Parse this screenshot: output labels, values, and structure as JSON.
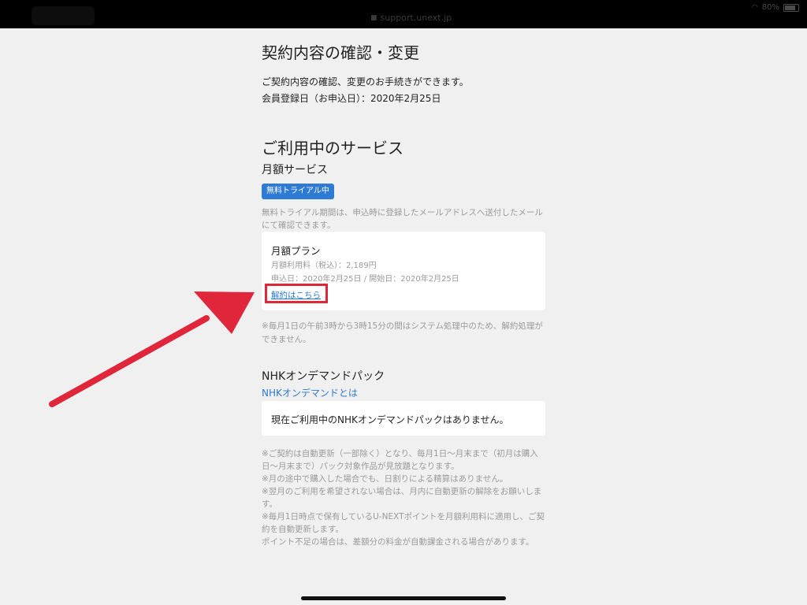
{
  "status_bar": {
    "url": "support.unext.jp",
    "battery": "80%"
  },
  "page": {
    "title": "契約内容の確認・変更",
    "intro_line1": "ご契約内容の確認、変更のお手続きができます。",
    "intro_line2": "会員登録日（お申込日）：2020年2月25日"
  },
  "services": {
    "title": "ご利用中のサービス",
    "monthly_title": "月額サービス",
    "trial_badge": "無料トライアル中",
    "trial_note": "無料トライアル期間は、申込時に登録したメールアドレスへ送付したメールにて確認できます。",
    "plan": {
      "name": "月額プラン",
      "fee": "月額利用料（税込）：2,189円",
      "dates": "申込日：2020年2月25日 / 開始日：2020年2月25日",
      "cancel_link": "解約はこちら"
    },
    "maintenance_note": "※毎月1日の午前3時から3時15分の間はシステム処理中のため、解約処理ができません。"
  },
  "nhk": {
    "title": "NHKオンデマンドパック",
    "about_link": "NHKオンデマンドとは",
    "card_text": "現在ご利用中のNHKオンデマンドパックはありません。",
    "notes": [
      "※ご契約は自動更新（一部除く）となり、毎月1日〜月末まで（初月は購入日〜月末まで）パック対象作品が見放題となります。",
      "※月の途中で購入した場合でも、日割りによる精算はありません。",
      "※翌月のご利用を希望されない場合は、月内に自動更新の解除をお願いします。",
      "※毎月1日時点で保有しているU-NEXTポイントを月額利用料に適用し、ご契約を自動更新します。",
      "ポイント不足の場合は、差額分の料金が自動課金される場合があります。"
    ]
  },
  "colors": {
    "accent": "#2e7bd6",
    "annotation": "#e0263a"
  },
  "icons": [
    "lock-icon",
    "wifi-icon",
    "battery-icon",
    "annotation-arrow"
  ]
}
